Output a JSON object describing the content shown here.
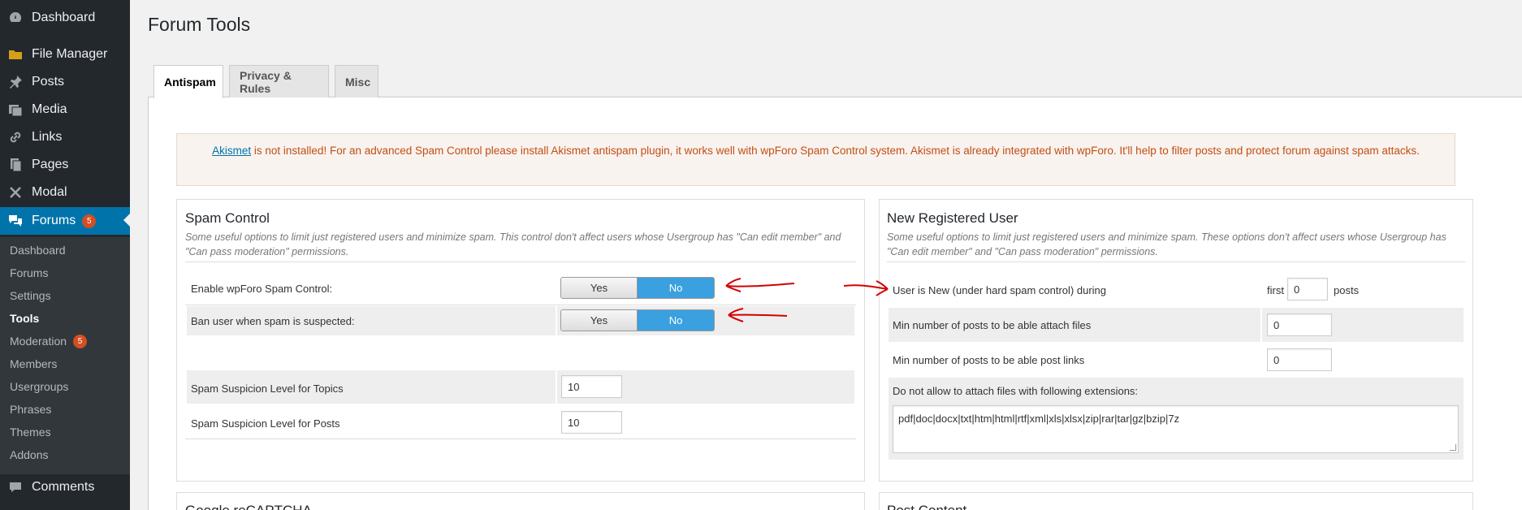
{
  "sidebar": {
    "top_items": [
      {
        "label": "Dashboard",
        "icon": "dashboard-icon"
      },
      {
        "label": "File Manager",
        "icon": "folder-icon"
      },
      {
        "label": "Posts",
        "icon": "pin-icon"
      },
      {
        "label": "Media",
        "icon": "media-icon"
      },
      {
        "label": "Links",
        "icon": "link-icon"
      },
      {
        "label": "Pages",
        "icon": "pages-icon"
      },
      {
        "label": "Modal",
        "icon": "move-icon"
      },
      {
        "label": "Forums",
        "icon": "forums-icon",
        "badge": "5"
      }
    ],
    "sub_items": [
      {
        "label": "Dashboard"
      },
      {
        "label": "Forums"
      },
      {
        "label": "Settings"
      },
      {
        "label": "Tools"
      },
      {
        "label": "Moderation",
        "badge": "5"
      },
      {
        "label": "Members"
      },
      {
        "label": "Usergroups"
      },
      {
        "label": "Phrases"
      },
      {
        "label": "Themes"
      },
      {
        "label": "Addons"
      }
    ],
    "comments": {
      "label": "Comments",
      "icon": "comments-icon"
    },
    "colors": {
      "bg": "#23282d",
      "active": "#0073aa",
      "submenu": "#32373c",
      "badge": "#d54e21"
    }
  },
  "page": {
    "title": "Forum Tools",
    "tabs": [
      {
        "label": "Antispam"
      },
      {
        "label": "Privacy & Rules"
      },
      {
        "label": "Misc"
      }
    ]
  },
  "notice": {
    "link_text": "Akismet",
    "text": " is not installed! For an advanced Spam Control please install Akismet antispam plugin, it works well with wpForo Spam Control system. Akismet is already integrated with wpForo. It'll help to filter posts and protect forum against spam attacks."
  },
  "spam_control": {
    "title": "Spam Control",
    "description": "Some useful options to limit just registered users and minimize spam. This control don't affect users whose Usergroup has \"Can edit member\" and \"Can pass moderation\" permissions.",
    "enable": {
      "label": "Enable wpForo Spam Control:",
      "yes": "Yes",
      "no": "No",
      "selected": "No"
    },
    "ban": {
      "label": "Ban user when spam is suspected:",
      "yes": "Yes",
      "no": "No",
      "selected": "No"
    },
    "level_topics": {
      "label": "Spam Suspicion Level for Topics",
      "value": "10"
    },
    "level_posts": {
      "label": "Spam Suspicion Level for Posts",
      "value": "10"
    }
  },
  "new_user": {
    "title": "New Registered User",
    "description": "Some useful options to limit just registered users and minimize spam. These options don't affect users whose Usergroup has \"Can edit member\" and \"Can pass moderation\" permissions.",
    "is_new": {
      "label": "User is New (under hard spam control) during",
      "prefix": "first",
      "value": "0",
      "suffix": "posts"
    },
    "attach": {
      "label": "Min number of posts to be able attach files",
      "value": "0"
    },
    "links": {
      "label": "Min number of posts to be able post links",
      "value": "0"
    },
    "extensions": {
      "label": "Do not allow to attach files with following extensions:",
      "value": "pdf|doc|docx|txt|htm|html|rtf|xml|xls|xlsx|zip|rar|tar|gz|bzip|7z"
    }
  },
  "lower_boxes": {
    "left_title": "Google reCAPTCHA",
    "right_title": "Post Content"
  },
  "colors": {
    "toggle_on": "#3aa0df",
    "notice_text": "#c24e14",
    "annotation_red": "#d40000"
  }
}
